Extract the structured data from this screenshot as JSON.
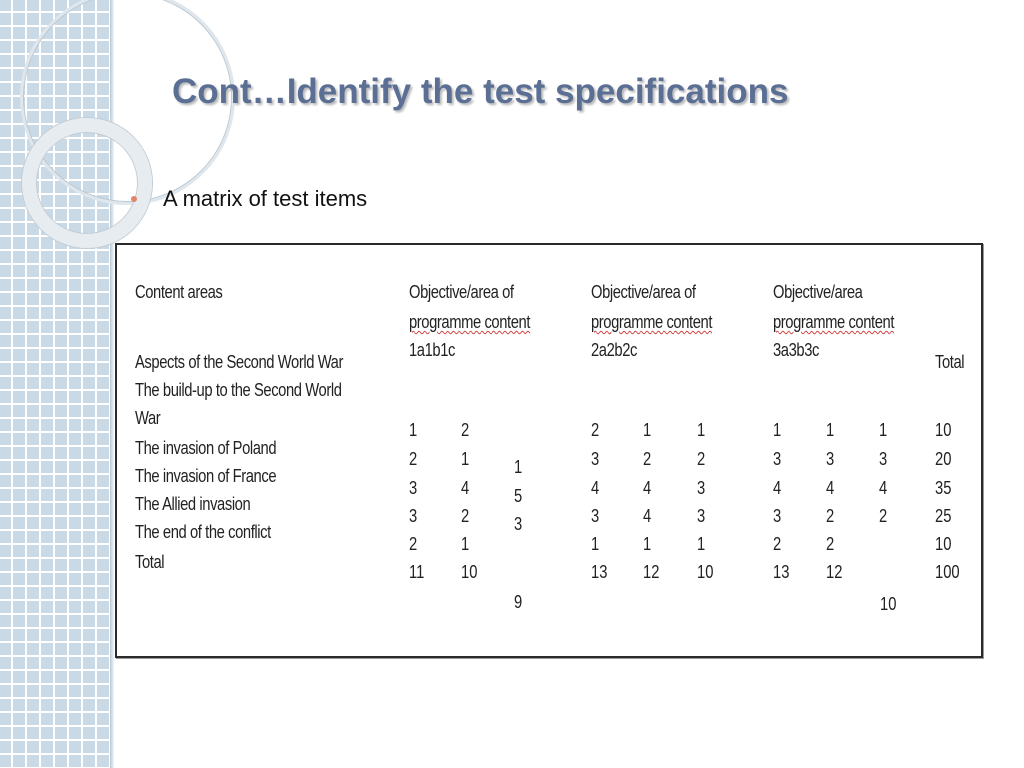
{
  "slide": {
    "title": "Cont…Identify the test specifications",
    "bullet": "A matrix of test items"
  },
  "table": {
    "header_content_areas": "Content areas",
    "objectives": [
      {
        "line1": "Objective/area of",
        "line2": "programme content",
        "line3": "1a1b1c"
      },
      {
        "line1": "Objective/area of",
        "line2": "programme content",
        "line3": "2a2b2c"
      },
      {
        "line1": "Objective/area",
        "line2": "programme content",
        "line3": "3a3b3c"
      }
    ],
    "total_header": "Total",
    "content_rows": [
      "Aspects of the Second World War",
      "The build-up to the Second World",
      "War",
      "The invasion of Poland",
      "The invasion of France",
      "The Allied invasion",
      "The end of the conflict",
      "Total"
    ],
    "rows": [
      [
        "1",
        "2",
        "",
        "2",
        "1",
        "1",
        "1",
        "1",
        "1",
        "10"
      ],
      [
        "2",
        "1",
        "1",
        "3",
        "2",
        "2",
        "3",
        "3",
        "3",
        "20"
      ],
      [
        "3",
        "4",
        "5",
        "4",
        "4",
        "3",
        "4",
        "4",
        "4",
        "35"
      ],
      [
        "3",
        "2",
        "3",
        "3",
        "4",
        "3",
        "3",
        "2",
        "2",
        "25"
      ],
      [
        "2",
        "1",
        "",
        "1",
        "1",
        "1",
        "2",
        "2",
        "",
        "10"
      ],
      [
        "11",
        "10",
        "",
        "13",
        "12",
        "10",
        "13",
        "12",
        "",
        "100"
      ]
    ],
    "extra_totals": [
      "9",
      "10"
    ]
  },
  "colors": {
    "title": "#5b6f95",
    "bullet": "#e0846c",
    "band": "#c9d9e6"
  }
}
